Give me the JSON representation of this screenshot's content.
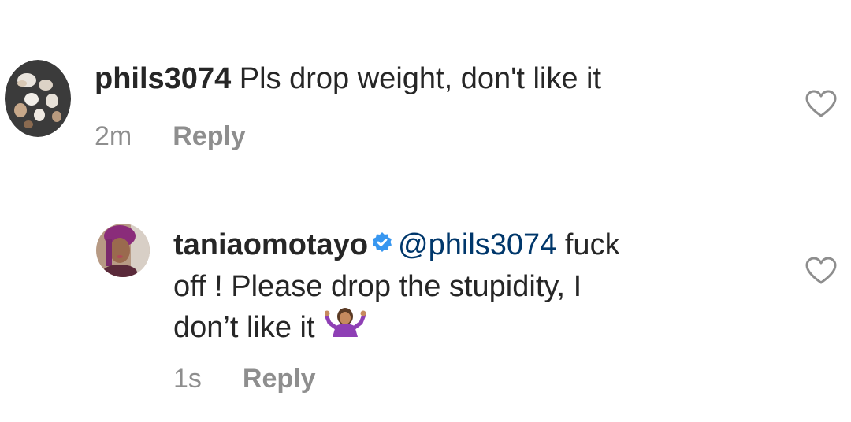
{
  "comments": [
    {
      "username": "phils3074",
      "text": "Pls drop weight, don't like it",
      "time": "2m",
      "reply_label": "Reply",
      "verified": false,
      "avatar_icon": "dogs-photo-avatar"
    },
    {
      "username": "taniaomotayo",
      "verified": true,
      "mention": "@phils3074",
      "text_line1": "fuck",
      "text_line2": "off ! Please drop the stupidity, I",
      "text_line3": "don’t like it",
      "emoji_icon": "person-shrugging-emoji",
      "time": "1s",
      "reply_label": "Reply",
      "avatar_icon": "woman-photo-avatar"
    }
  ],
  "colors": {
    "text": "#262626",
    "secondary": "#8e8e8e",
    "mention": "#00376b",
    "verified_badge": "#3897f0",
    "heart_outline": "#8e8e8e"
  }
}
